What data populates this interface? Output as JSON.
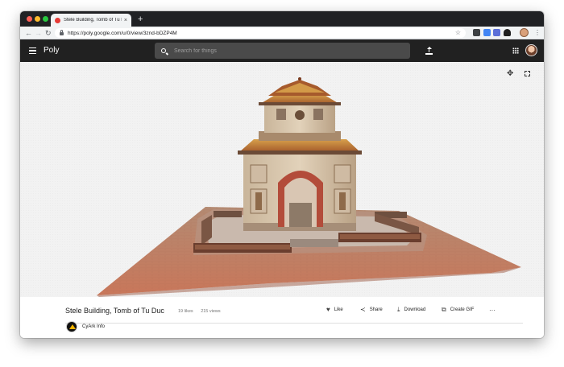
{
  "browser": {
    "tab_title": "Stele Building, Tomb of Tu Duc",
    "tab_close": "×",
    "new_tab": "+",
    "url": "https://poly.google.com/u/0/view/3znd-bDZP4M",
    "nav": {
      "back": "←",
      "forward": "→",
      "reload": "↻"
    },
    "bookmark_star": "☆",
    "menu": "⋮"
  },
  "app": {
    "brand": "Poly",
    "search_placeholder": "Search for things",
    "icons": [
      "menu-icon",
      "search-icon",
      "upload-icon",
      "apps-icon",
      "user-avatar"
    ]
  },
  "viewer": {
    "move_icon": "✥",
    "model_subject": "3D model of a temple building on a brick platform"
  },
  "model": {
    "title": "Stele Building, Tomb of Tu Duc",
    "likes": "19 likes",
    "views": "215 views",
    "actions": {
      "like": "Like",
      "share": "Share",
      "download": "Download",
      "create_gif": "Create GIF",
      "more": "···"
    },
    "author": "CyArk Info"
  },
  "colors": {
    "appbar": "#212121",
    "chrome_tabstrip": "#202124",
    "viewer_bg": "#f2f2f2"
  }
}
